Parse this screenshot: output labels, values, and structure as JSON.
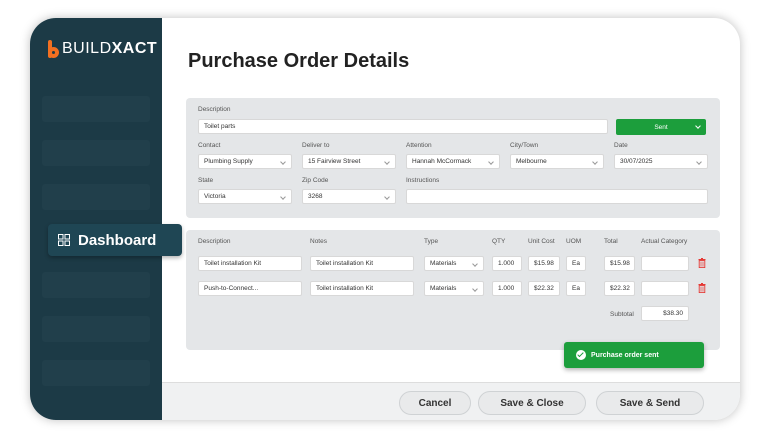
{
  "brand": {
    "light": "BUILD",
    "bold": "XACT",
    "accent": "#f37021"
  },
  "sidebar": {
    "dashboard_label": "Dashboard"
  },
  "page_title": "Purchase Order Details",
  "details": {
    "description_label": "Description",
    "description_value": "Toilet parts",
    "status_value": "Sent",
    "contact_label": "Contact",
    "contact_value": "Plumbing Supply",
    "deliver_label": "Deliver to",
    "deliver_value": "15 Fairview Street",
    "attention_label": "Attention",
    "attention_value": "Hannah McCormack",
    "city_label": "City/Town",
    "city_value": "Melbourne",
    "date_label": "Date",
    "date_value": "30/07/2025",
    "state_label": "State",
    "state_value": "Victoria",
    "zip_label": "Zip Code",
    "zip_value": "3268",
    "instructions_label": "Instructions",
    "instructions_value": ""
  },
  "items": {
    "headers": [
      "Description",
      "Notes",
      "Type",
      "QTY",
      "Unit Cost",
      "UOM",
      "Total",
      "Actual Category"
    ],
    "rows": [
      {
        "description": "Toilet installation Kit",
        "notes": "Toilet installation Kit",
        "type": "Materials",
        "qty": "1.000",
        "unit_cost": "$15.98",
        "uom": "Ea",
        "total": "$15.98",
        "category": ""
      },
      {
        "description": "Push-to-Connect...",
        "notes": "Toilet installation Kit",
        "type": "Materials",
        "qty": "1.000",
        "unit_cost": "$22.32",
        "uom": "Ea",
        "total": "$22.32",
        "category": ""
      }
    ],
    "subtotal_label": "Subtotal",
    "subtotal_value": "$38.30"
  },
  "toast": "Purchase order sent",
  "buttons": {
    "cancel": "Cancel",
    "save_close": "Save & Close",
    "save_send": "Save & Send"
  },
  "colors": {
    "sidebar": "#1c3a46",
    "success": "#1c9e3c",
    "danger": "#e53935"
  }
}
